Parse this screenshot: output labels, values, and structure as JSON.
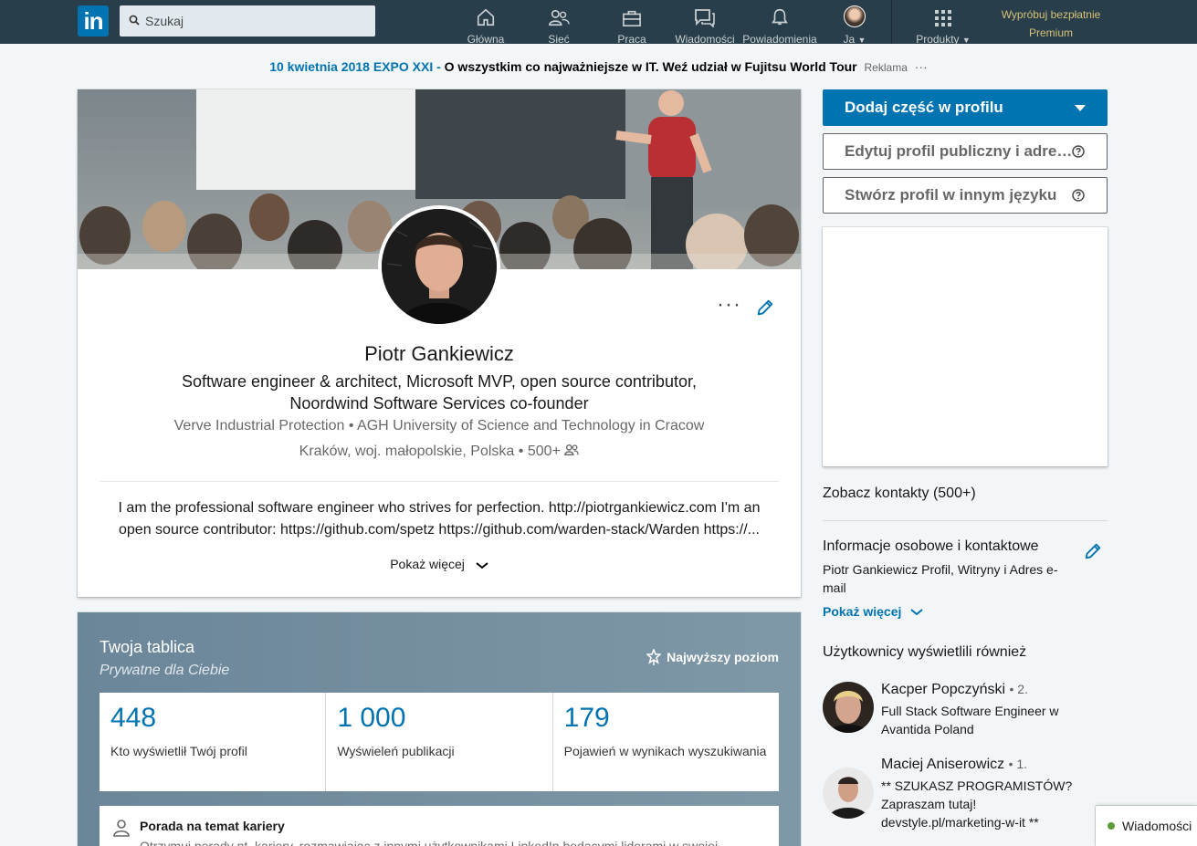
{
  "nav": {
    "logo": "in",
    "search_placeholder": "Szukaj",
    "items": [
      {
        "label": "Główna",
        "icon": "home-icon"
      },
      {
        "label": "Sieć",
        "icon": "network-icon"
      },
      {
        "label": "Praca",
        "icon": "briefcase-icon"
      },
      {
        "label": "Wiadomości",
        "icon": "messages-icon"
      },
      {
        "label": "Powiadomienia",
        "icon": "bell-icon"
      },
      {
        "label": "Ja",
        "icon": "avatar"
      },
      {
        "label": "Produkty",
        "icon": "grid-icon"
      }
    ],
    "premium_line1": "Wypróbuj bezpłatnie",
    "premium_line2": "Premium"
  },
  "ad": {
    "link": "10 kwietnia 2018 EXPO XXI -",
    "text": "O wszystkim co najważniejsze w IT. Weź udział w Fujitsu World Tour",
    "label": "Reklama",
    "more": "···"
  },
  "profile": {
    "name": "Piotr Gankiewicz",
    "headline": "Software engineer & architect, Microsoft MVP, open source contributor, Noordwind Software Services co-founder",
    "company": "Verve Industrial Protection",
    "school": "AGH University of Science and Technology in Cracow",
    "location": "Kraków, woj. małopolskie, Polska",
    "connections": "500+",
    "summary_line1": "I am the professional software engineer who strives for perfection. http://piotrgankiewicz.com I'm an",
    "summary_line2": "open source contributor: https://github.com/spetz https://github.com/warden-stack/Warden https://...",
    "show_more": "Pokaż więcej",
    "more_actions": "···"
  },
  "dashboard": {
    "title": "Twoja tablica",
    "subtitle": "Prywatne dla Ciebie",
    "level": "Najwyższy poziom",
    "stats": [
      {
        "value": "448",
        "label": "Kto wyświetlił Twój profil"
      },
      {
        "value": "1 000",
        "label": "Wyświeleń publikacji"
      },
      {
        "value": "179",
        "label": "Pojawień w wynikach wyszukiwania"
      }
    ],
    "advice_title": "Porada na temat kariery",
    "advice_desc": "Otrzymuj porady nt. kariery, rozmawiając z innymi użytkownikami LinkedIn będącymi liderami w swojej"
  },
  "rail": {
    "add_section": "Dodaj część w profilu",
    "edit_public": "Edytuj profil publiczny i adres URL",
    "other_language": "Stwórz profil w innym języku",
    "see_contacts": "Zobacz kontakty (500+)",
    "contact_title": "Informacje osobowe i kontaktowe",
    "contact_desc": "Piotr Gankiewicz Profil, Witryny i Adres e-mail",
    "contact_more": "Pokaż więcej",
    "also_viewed_title": "Użytkownicy wyświetlili również",
    "people": [
      {
        "name": "Kacper Popczyński",
        "degree": "• 2.",
        "headline": "Full Stack Software Engineer w Avantida Poland"
      },
      {
        "name": "Maciej Aniserowicz",
        "degree": "• 1.",
        "headline": "** SZUKASZ PROGRAMISTÓW? Zapraszam tutaj! devstyle.pl/marketing-w-it **"
      }
    ]
  },
  "messaging": {
    "label": "Wiadomości",
    "status_color": "#5a9c35"
  },
  "colors": {
    "nav_bg": "#283e4a",
    "brand": "#0073b1",
    "premium": "#f5d97f"
  }
}
